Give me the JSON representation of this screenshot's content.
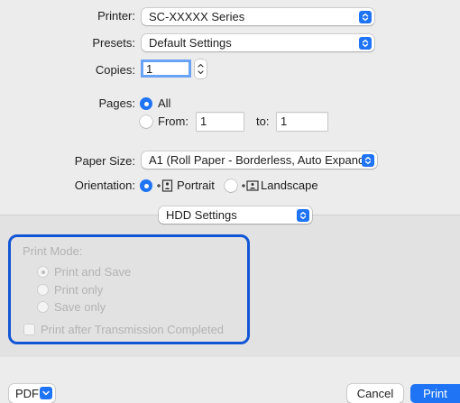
{
  "printer": {
    "label": "Printer:",
    "value": "SC-XXXXX Series"
  },
  "presets": {
    "label": "Presets:",
    "value": "Default Settings"
  },
  "copies": {
    "label": "Copies:",
    "value": "1"
  },
  "pages": {
    "label": "Pages:",
    "all_label": "All",
    "from_label": "From:",
    "from_value": "1",
    "to_label": "to:",
    "to_value": "1"
  },
  "paper_size": {
    "label": "Paper Size:",
    "value": "A1 (Roll Paper - Borderless, Auto Expand..."
  },
  "orientation": {
    "label": "Orientation:",
    "portrait": "Portrait",
    "landscape": "Landscape"
  },
  "section_popup": {
    "value": "HDD Settings"
  },
  "print_mode": {
    "label": "Print Mode:",
    "options": [
      "Print and Save",
      "Print only",
      "Save only"
    ],
    "selected": "Print and Save",
    "checkbox_label": "Print after Transmission Completed"
  },
  "footer": {
    "pdf_label": "PDF",
    "cancel_label": "Cancel",
    "print_label": "Print"
  },
  "colors": {
    "accent": "#1f74f5",
    "highlight_border": "#1256d6"
  }
}
